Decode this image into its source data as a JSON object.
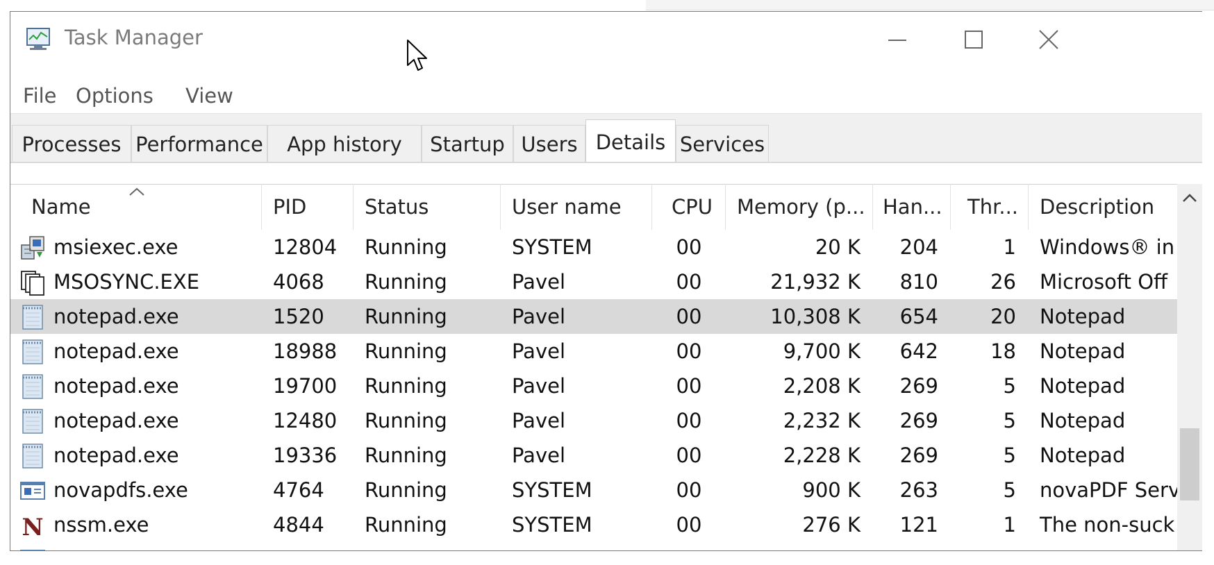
{
  "window": {
    "title": "Task Manager",
    "controls": {
      "minimize": "minimize",
      "maximize": "maximize",
      "close": "close"
    }
  },
  "menu": [
    "File",
    "Options",
    "View"
  ],
  "tabs": [
    {
      "label": "Processes"
    },
    {
      "label": "Performance"
    },
    {
      "label": "App history"
    },
    {
      "label": "Startup"
    },
    {
      "label": "Users"
    },
    {
      "label": "Details",
      "active": true
    },
    {
      "label": "Services"
    }
  ],
  "columns": [
    "Name",
    "PID",
    "Status",
    "User name",
    "CPU",
    "Memory (p...",
    "Han...",
    "Thr...",
    "Description"
  ],
  "rows": [
    {
      "icon": "installer-icon",
      "name": "msiexec.exe",
      "pid": "12804",
      "status": "Running",
      "user": "SYSTEM",
      "cpu": "00",
      "memory": "20 K",
      "handles": "204",
      "threads": "1",
      "description": "Windows® in"
    },
    {
      "icon": "documents-icon",
      "name": "MSOSYNC.EXE",
      "pid": "4068",
      "status": "Running",
      "user": "Pavel",
      "cpu": "00",
      "memory": "21,932 K",
      "handles": "810",
      "threads": "26",
      "description": "Microsoft Off"
    },
    {
      "icon": "notepad-icon",
      "name": "notepad.exe",
      "pid": "1520",
      "status": "Running",
      "user": "Pavel",
      "cpu": "00",
      "memory": "10,308 K",
      "handles": "654",
      "threads": "20",
      "description": "Notepad",
      "selected": true
    },
    {
      "icon": "notepad-icon",
      "name": "notepad.exe",
      "pid": "18988",
      "status": "Running",
      "user": "Pavel",
      "cpu": "00",
      "memory": "9,700 K",
      "handles": "642",
      "threads": "18",
      "description": "Notepad"
    },
    {
      "icon": "notepad-icon",
      "name": "notepad.exe",
      "pid": "19700",
      "status": "Running",
      "user": "Pavel",
      "cpu": "00",
      "memory": "2,208 K",
      "handles": "269",
      "threads": "5",
      "description": "Notepad"
    },
    {
      "icon": "notepad-icon",
      "name": "notepad.exe",
      "pid": "12480",
      "status": "Running",
      "user": "Pavel",
      "cpu": "00",
      "memory": "2,232 K",
      "handles": "269",
      "threads": "5",
      "description": "Notepad"
    },
    {
      "icon": "notepad-icon",
      "name": "notepad.exe",
      "pid": "19336",
      "status": "Running",
      "user": "Pavel",
      "cpu": "00",
      "memory": "2,228 K",
      "handles": "269",
      "threads": "5",
      "description": "Notepad"
    },
    {
      "icon": "window-icon",
      "name": "novapdfs.exe",
      "pid": "4764",
      "status": "Running",
      "user": "SYSTEM",
      "cpu": "00",
      "memory": "900 K",
      "handles": "263",
      "threads": "5",
      "description": "novaPDF Serv"
    },
    {
      "icon": "nssm-icon",
      "name": "nssm.exe",
      "pid": "4844",
      "status": "Running",
      "user": "SYSTEM",
      "cpu": "00",
      "memory": "276 K",
      "handles": "121",
      "threads": "1",
      "description": "The non-suck"
    }
  ],
  "colors": {
    "selected_row": "#d9d9d9",
    "title_text": "#7a7a7a",
    "tabs_bg": "#f0f0f0"
  }
}
